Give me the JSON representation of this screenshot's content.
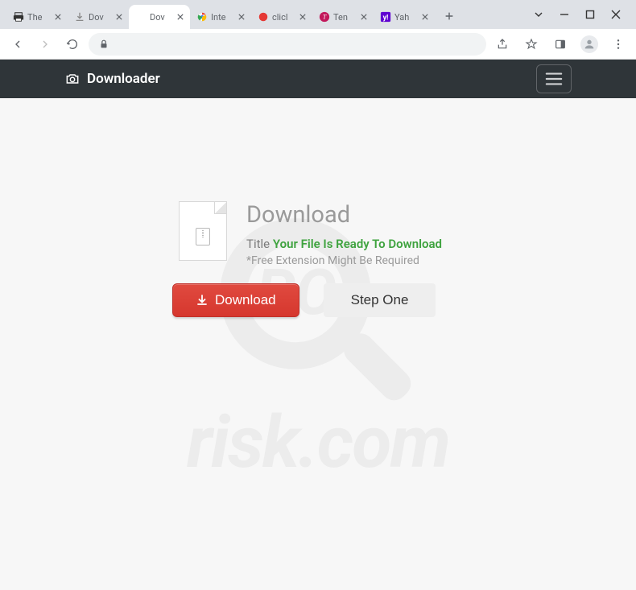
{
  "window": {
    "tabs": [
      {
        "title": "The",
        "favicon": "printer"
      },
      {
        "title": "Dov",
        "favicon": "download"
      },
      {
        "title": "Dov",
        "favicon": "blank",
        "active": true
      },
      {
        "title": "Inte",
        "favicon": "chrome"
      },
      {
        "title": "clicl",
        "favicon": "red-dot"
      },
      {
        "title": "Ten",
        "favicon": "purple-t"
      },
      {
        "title": "Yah",
        "favicon": "yahoo"
      }
    ]
  },
  "page": {
    "brand": "Downloader",
    "heading": "Download",
    "title_label": "Title",
    "title_value": "Your File Is Ready To Download",
    "note": "*Free Extension Might Be Required",
    "download_button": "Download",
    "step_button": "Step One"
  },
  "watermark": {
    "text": "risk.com"
  }
}
